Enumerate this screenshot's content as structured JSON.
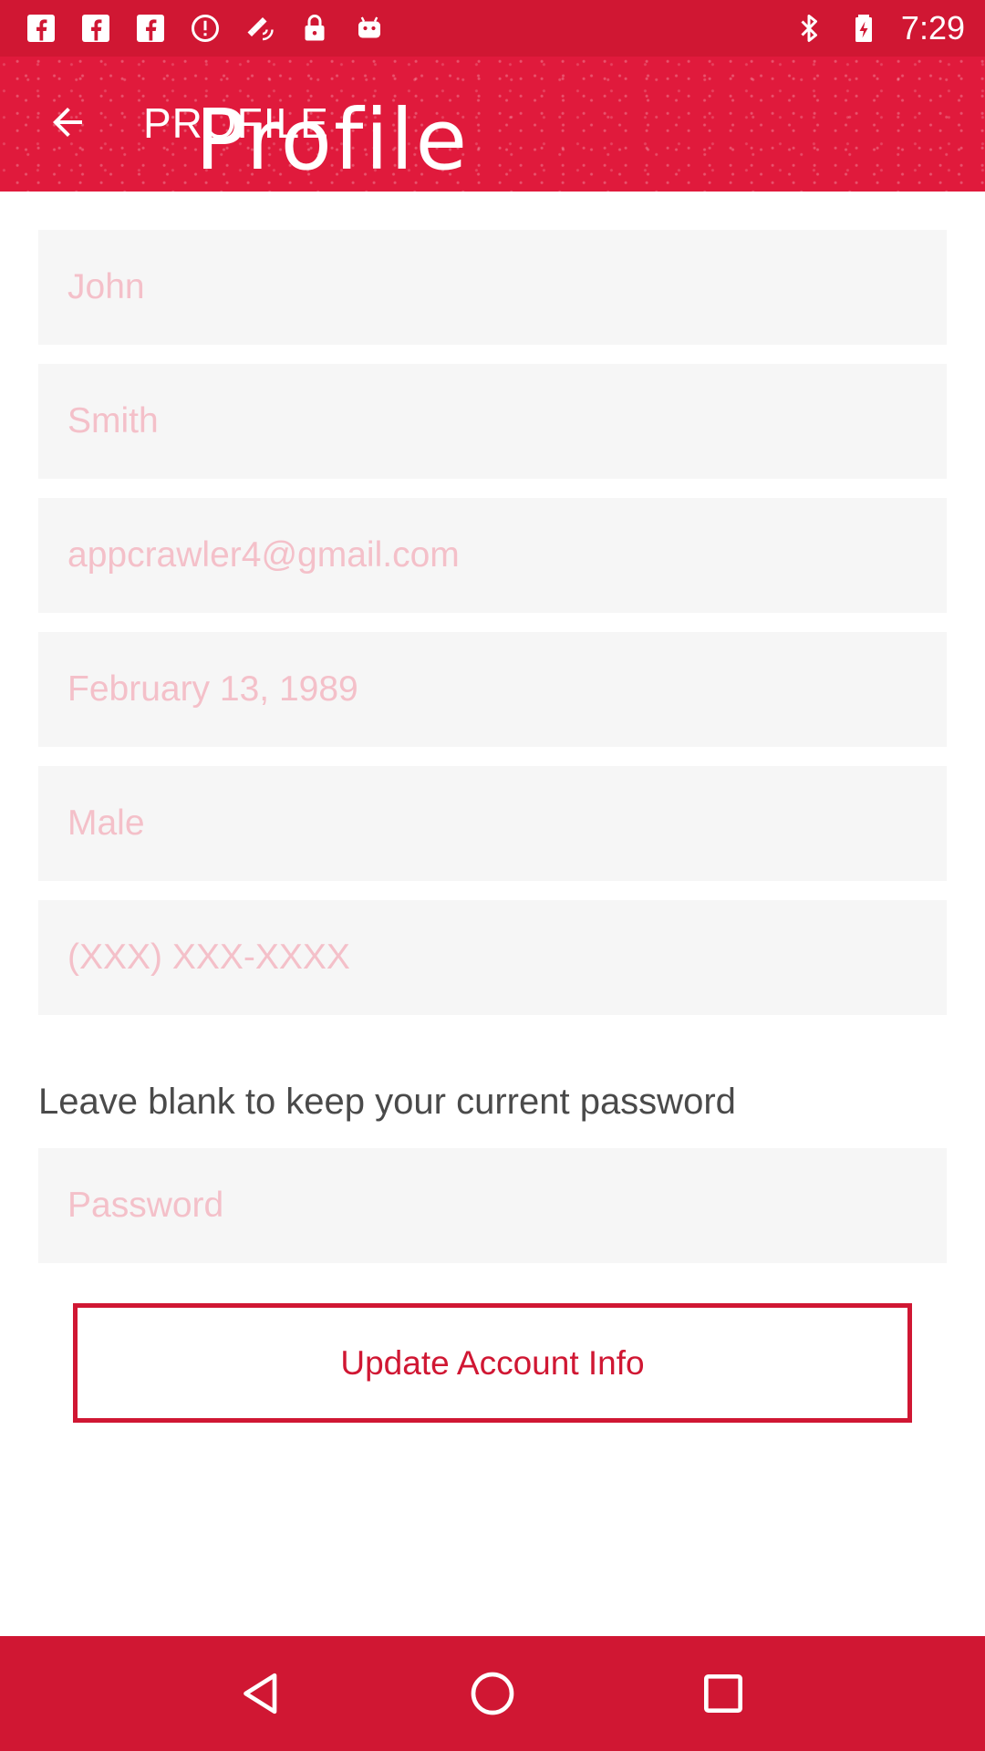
{
  "status_bar": {
    "time": "7:29",
    "left_icons": [
      "facebook-icon",
      "facebook-icon",
      "facebook-icon",
      "alert-icon",
      "fake-gps-icon",
      "lock-icon",
      "android-icon"
    ],
    "right_icons": [
      "bluetooth-icon",
      "battery-icon"
    ]
  },
  "app_bar": {
    "title_small": "PROFILE",
    "title_large": "Profile",
    "background_color": "#e01a3c"
  },
  "form": {
    "first_name": "John",
    "last_name": "Smith",
    "email": "appcrawler4@gmail.com",
    "birthdate": "February 13, 1989",
    "gender": "Male",
    "phone_placeholder": "(XXX) XXX-XXXX",
    "password_hint": "Leave blank to keep your current password",
    "password_placeholder": "Password",
    "update_button_label": "Update Account Info"
  },
  "colors": {
    "accent": "#d01733",
    "field_background": "#f6f6f6",
    "field_text": "#f4c0c9"
  },
  "nav_bar": {
    "buttons": [
      "back-triangle-icon",
      "home-circle-icon",
      "recents-square-icon"
    ]
  }
}
